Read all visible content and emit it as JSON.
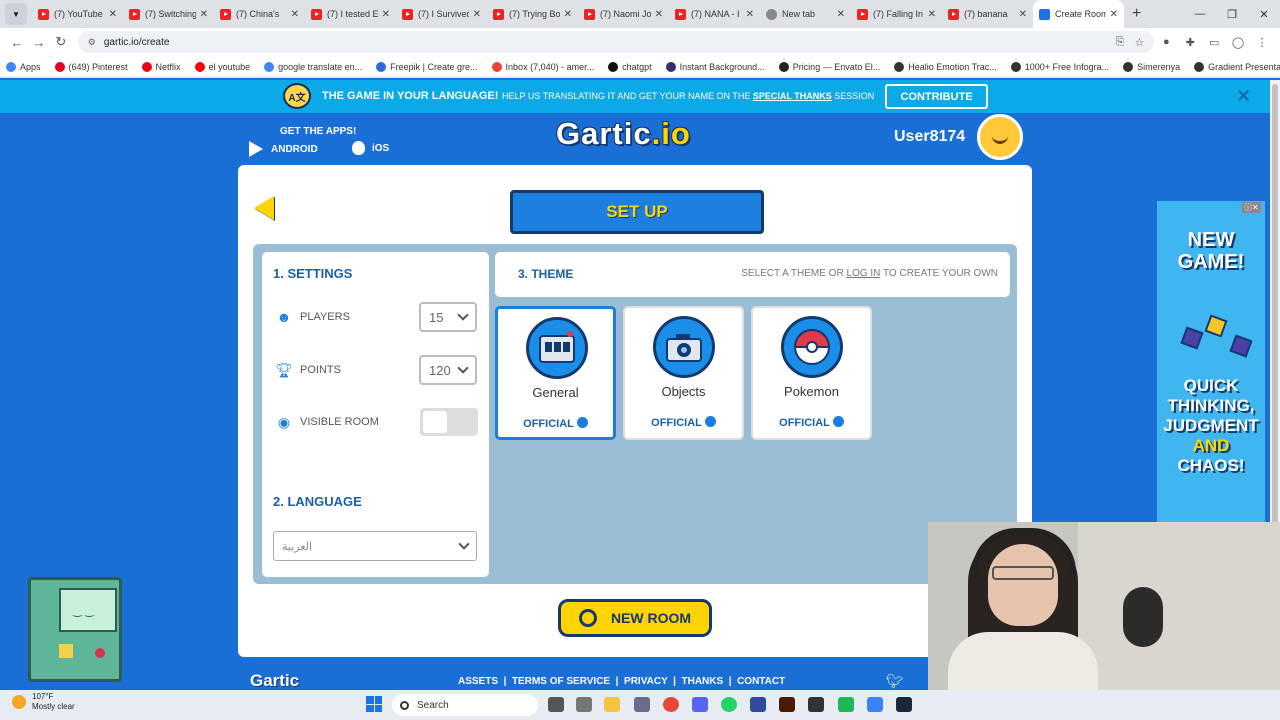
{
  "browser": {
    "tabs": [
      {
        "title": "(7) YouTube",
        "type": "yt"
      },
      {
        "title": "(7) Switching",
        "type": "yt"
      },
      {
        "title": "(7) China's",
        "type": "yt"
      },
      {
        "title": "(7) I tested E",
        "type": "yt"
      },
      {
        "title": "(7) I Survived",
        "type": "yt"
      },
      {
        "title": "(7) Trying Bo",
        "type": "yt"
      },
      {
        "title": "(7) Naomi Jo",
        "type": "yt"
      },
      {
        "title": "(7) NANA - I",
        "type": "yt"
      },
      {
        "title": "New tab",
        "type": "nt"
      },
      {
        "title": "(7) Falling In",
        "type": "yt"
      },
      {
        "title": "(7) banana",
        "type": "yt"
      },
      {
        "title": "Create Room",
        "type": "gc",
        "active": true
      }
    ],
    "url": "gartic.io/create",
    "bookmarks": [
      "Apps",
      "(649) Pinterest",
      "Netflix",
      "el youtube",
      "google translate en...",
      "Freepik | Create gre...",
      "Inbox (7,040) - amer...",
      "chatgpt",
      "Instant Background...",
      "Pricing — Envato El...",
      "Healio Emotion Trac...",
      "1000+ Free Infogra...",
      "Simerenya",
      "Gradient Presentati..."
    ],
    "bookmark_colors": [
      "#4285f4",
      "#e60023",
      "#e50914",
      "#ff0000",
      "#4285f4",
      "#2c6bd9",
      "#ea4335",
      "#111111",
      "#2f2f6f",
      "#222222",
      "#333333",
      "#333333",
      "#333333",
      "#333333"
    ]
  },
  "banner": {
    "icon_text": "A文",
    "title": "THE GAME IN YOUR LANGUAGE!",
    "text": "HELP US TRANSLATING IT AND GET YOUR NAME ON THE",
    "link": "SPECIAL THANKS",
    "text_end": "SESSION",
    "button": "CONTRIBUTE",
    "close": "✕"
  },
  "header": {
    "get_apps": "GET THE APPS!",
    "android": "ANDROID",
    "ios": "iOS",
    "logo_main": "Gartic",
    "logo_accent": ".io",
    "username": "User8174"
  },
  "setup": {
    "title": "SET UP",
    "settings_heading": "1. SETTINGS",
    "players_label": "PLAYERS",
    "players_value": "15",
    "points_label": "POINTS",
    "points_value": "120",
    "visible_label": "VISIBLE ROOM",
    "visible_on": false,
    "language_heading": "2. LANGUAGE",
    "language_value": "العربية"
  },
  "theme": {
    "heading": "3. THEME",
    "hint_prefix": "SELECT A THEME OR",
    "hint_link": "LOG IN",
    "hint_suffix": "TO CREATE YOUR OWN",
    "cards": [
      {
        "name": "General",
        "badge": "OFFICIAL",
        "selected": true,
        "icon": "slot-machine-icon"
      },
      {
        "name": "Objects",
        "badge": "OFFICIAL",
        "selected": false,
        "icon": "camera-icon"
      },
      {
        "name": "Pokemon",
        "badge": "OFFICIAL",
        "selected": false,
        "icon": "pokeball-icon"
      }
    ]
  },
  "new_room": "NEW ROOM",
  "footer": {
    "logo": "Gartic",
    "links": [
      "ASSETS",
      "TERMS OF SERVICE",
      "PRIVACY",
      "THANKS",
      "CONTACT"
    ]
  },
  "ad": {
    "line1": "NEW GAME!",
    "line2a": "QUICK THINKING, JUDGMENT",
    "line2b": "AND",
    "line2c": "CHAOS!"
  },
  "taskbar": {
    "temp": "107°F",
    "weather": "Mostly clear",
    "search": "Search"
  },
  "colors": {
    "brand_blue": "#1a6fd6",
    "accent_yellow": "#ffd400",
    "banner": "#0ba9e6",
    "navy": "#14396e"
  }
}
